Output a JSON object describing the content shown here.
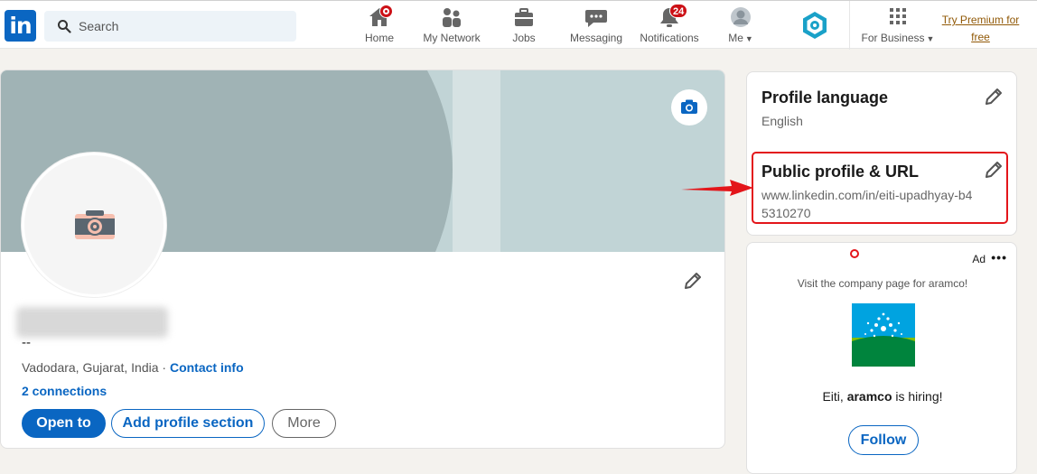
{
  "nav": {
    "logo_text": "in",
    "search_placeholder": "Search",
    "items": [
      {
        "label": "Home"
      },
      {
        "label": "My Network"
      },
      {
        "label": "Jobs"
      },
      {
        "label": "Messaging"
      },
      {
        "label": "Notifications",
        "badge": "24"
      },
      {
        "label": "Me"
      },
      {
        "label": "For Business"
      }
    ],
    "premium": "Try Premium for free"
  },
  "profile": {
    "headline": "--",
    "location": "Vadodara, Gujarat, India",
    "separator": " · ",
    "contact_info": "Contact info",
    "connections": "2 connections",
    "buttons": {
      "open_to": "Open to",
      "add_section": "Add profile section",
      "more": "More"
    }
  },
  "sidebar": {
    "language_title": "Profile language",
    "language_value": "English",
    "url_title": "Public profile & URL",
    "url_value": "www.linkedin.com/in/eiti-upadhyay-b45310270"
  },
  "ad": {
    "label": "Ad",
    "visit_text": "Visit the company page for aramco!",
    "hiring_prefix": "Eiti, ",
    "hiring_company": "aramco",
    "hiring_suffix": " is hiring!",
    "follow": "Follow"
  },
  "colors": {
    "brand": "#0a66c2",
    "highlight": "#e3151a",
    "badge": "#cc1016",
    "premium": "#915907"
  }
}
